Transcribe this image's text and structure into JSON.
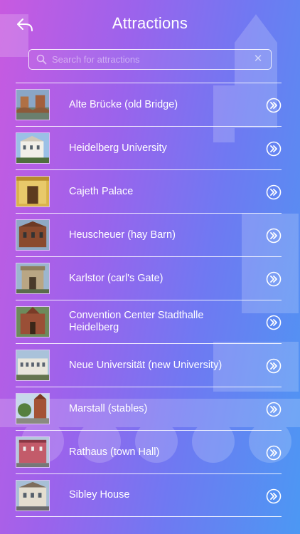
{
  "header": {
    "title": "Attractions"
  },
  "search": {
    "placeholder": "Search for attractions"
  },
  "icons": {
    "back": "back-arrow-icon",
    "search": "search-icon",
    "clear": "clear-icon",
    "row_action": "double-chevron-right-icon"
  },
  "colors": {
    "gradient_start": "#c85ae0",
    "gradient_end": "#4c98f3",
    "text": "#ffffff"
  },
  "attractions": [
    {
      "name": "Alte Brücke (old Bridge)"
    },
    {
      "name": "Heidelberg University"
    },
    {
      "name": "Cajeth Palace"
    },
    {
      "name": "Heuscheuer (hay Barn)"
    },
    {
      "name": "Karlstor (carl's Gate)"
    },
    {
      "name": "Convention Center Stadthalle Heidelberg"
    },
    {
      "name": "Neue Universität (new University)"
    },
    {
      "name": "Marstall (stables)"
    },
    {
      "name": "Rathaus (town Hall)"
    },
    {
      "name": "Sibley House"
    }
  ]
}
